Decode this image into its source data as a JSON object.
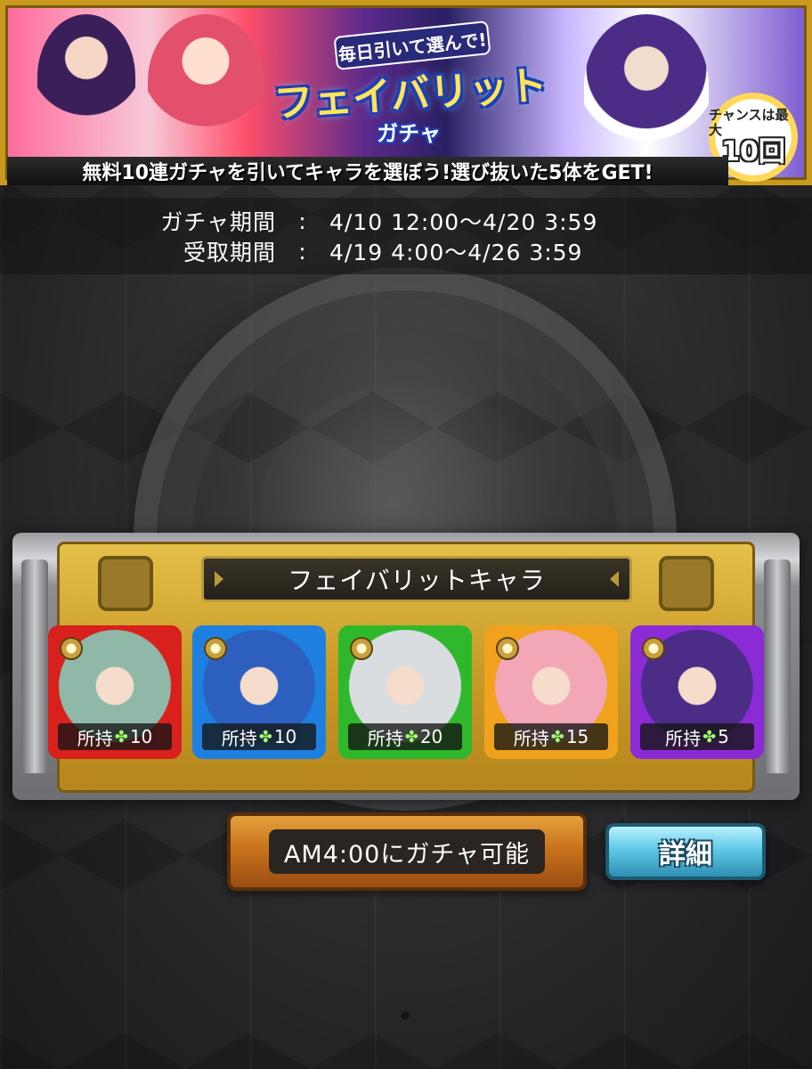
{
  "banner": {
    "subtitle": "毎日引いて選んで!",
    "title": "フェイバリット",
    "title_sub": "ガチャ",
    "ribbon": "無料10連ガチャを引いてキャラを選ぼう!選び抜いた5体をGET!",
    "chance_label": "チャンスは最大",
    "chance_count": "10回"
  },
  "periods": {
    "gacha": {
      "label": "ガチャ期間",
      "sep": ":",
      "value": "4/10 12:00〜4/20 3:59"
    },
    "receive": {
      "label": "受取期間",
      "sep": ":",
      "value": "4/19 4:00〜4/26 3:59"
    }
  },
  "favorite": {
    "title": "フェイバリットキャラ",
    "characters": [
      {
        "element": "fire",
        "frame_color": "#d8201c",
        "face_color": "#8fb8a8",
        "owned_label": "所持",
        "clover": "✤",
        "count": "10"
      },
      {
        "element": "water",
        "frame_color": "#1f7fe0",
        "face_color": "#2d5fbf",
        "owned_label": "所持",
        "clover": "✤",
        "count": "10"
      },
      {
        "element": "wood",
        "frame_color": "#2fb82c",
        "face_color": "#d9dde0",
        "owned_label": "所持",
        "clover": "✤",
        "count": "20"
      },
      {
        "element": "light",
        "frame_color": "#f0a21c",
        "face_color": "#f2a6b6",
        "owned_label": "所持",
        "clover": "✤",
        "count": "15"
      },
      {
        "element": "dark",
        "frame_color": "#8a2bd6",
        "face_color": "#4b2c86",
        "owned_label": "所持",
        "clover": "✤",
        "count": "5"
      }
    ]
  },
  "buttons": {
    "gacha": "AM4:00にガチャ可能",
    "detail": "詳細"
  }
}
